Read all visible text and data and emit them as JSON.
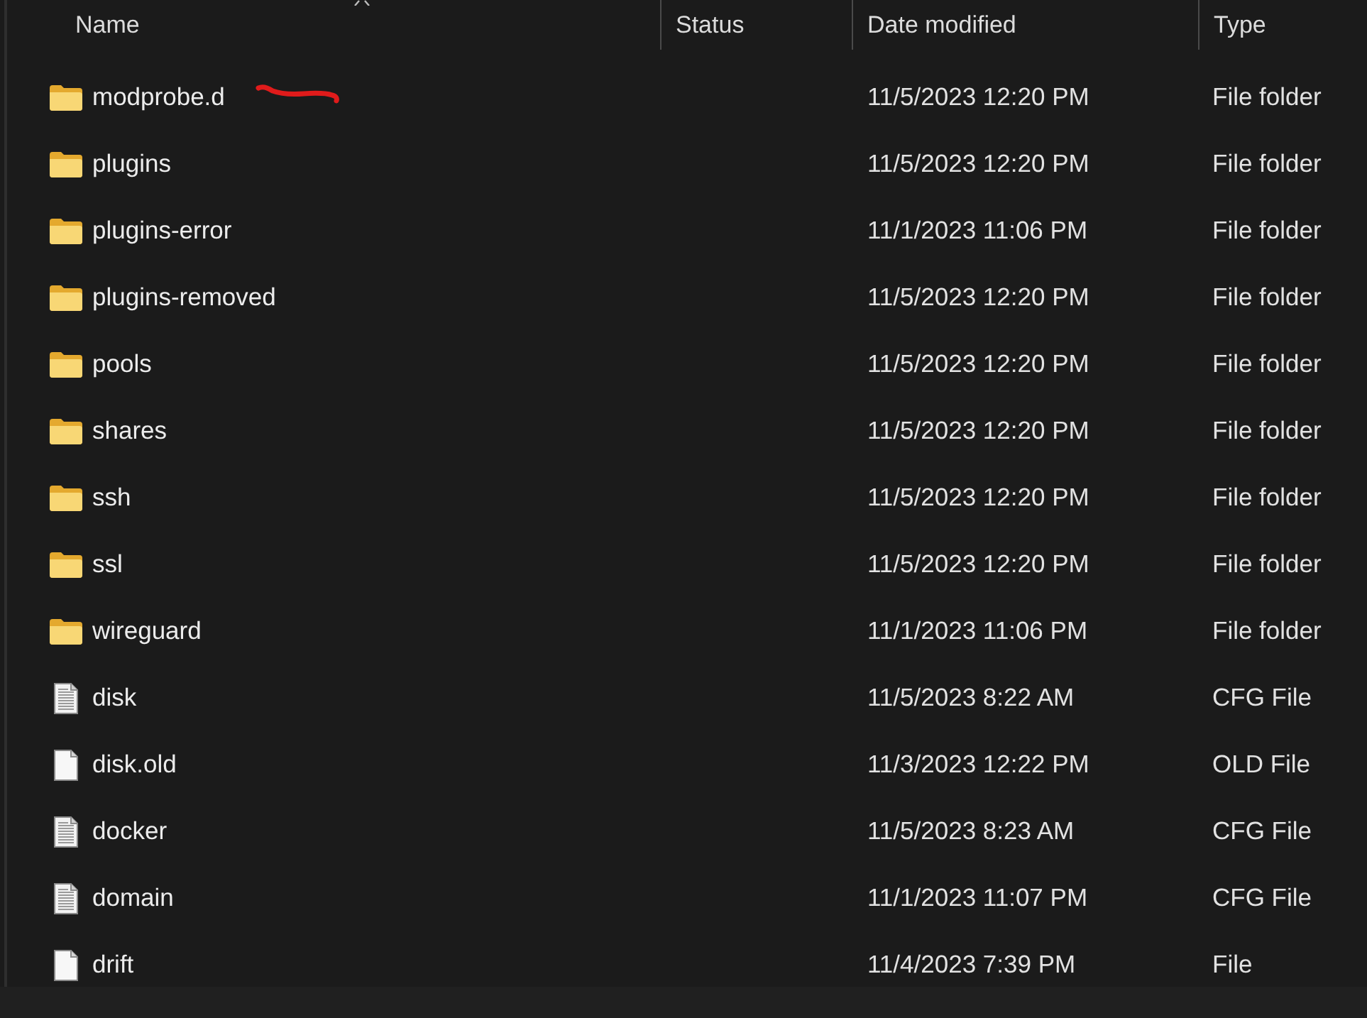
{
  "columns": [
    {
      "label": "Name",
      "sorted": true
    },
    {
      "label": "Status",
      "sorted": false
    },
    {
      "label": "Date modified",
      "sorted": false
    },
    {
      "label": "Type",
      "sorted": false
    }
  ],
  "rows": [
    {
      "kind": "folder",
      "name": "modprobe.d",
      "annotated": true,
      "modified": "11/5/2023 12:20 PM",
      "type": "File folder"
    },
    {
      "kind": "folder",
      "name": "plugins",
      "annotated": false,
      "modified": "11/5/2023 12:20 PM",
      "type": "File folder"
    },
    {
      "kind": "folder",
      "name": "plugins-error",
      "annotated": false,
      "modified": "11/1/2023 11:06 PM",
      "type": "File folder"
    },
    {
      "kind": "folder",
      "name": "plugins-removed",
      "annotated": false,
      "modified": "11/5/2023 12:20 PM",
      "type": "File folder"
    },
    {
      "kind": "folder",
      "name": "pools",
      "annotated": false,
      "modified": "11/5/2023 12:20 PM",
      "type": "File folder"
    },
    {
      "kind": "folder",
      "name": "shares",
      "annotated": false,
      "modified": "11/5/2023 12:20 PM",
      "type": "File folder"
    },
    {
      "kind": "folder",
      "name": "ssh",
      "annotated": false,
      "modified": "11/5/2023 12:20 PM",
      "type": "File folder"
    },
    {
      "kind": "folder",
      "name": "ssl",
      "annotated": false,
      "modified": "11/5/2023 12:20 PM",
      "type": "File folder"
    },
    {
      "kind": "folder",
      "name": "wireguard",
      "annotated": false,
      "modified": "11/1/2023 11:06 PM",
      "type": "File folder"
    },
    {
      "kind": "text",
      "name": "disk",
      "annotated": false,
      "modified": "11/5/2023 8:22 AM",
      "type": "CFG File"
    },
    {
      "kind": "blank",
      "name": "disk.old",
      "annotated": false,
      "modified": "11/3/2023 12:22 PM",
      "type": "OLD File"
    },
    {
      "kind": "text",
      "name": "docker",
      "annotated": false,
      "modified": "11/5/2023 8:23 AM",
      "type": "CFG File"
    },
    {
      "kind": "text",
      "name": "domain",
      "annotated": false,
      "modified": "11/1/2023 11:07 PM",
      "type": "CFG File"
    },
    {
      "kind": "blank",
      "name": "drift",
      "annotated": false,
      "modified": "11/4/2023 7:39 PM",
      "type": "File"
    }
  ]
}
